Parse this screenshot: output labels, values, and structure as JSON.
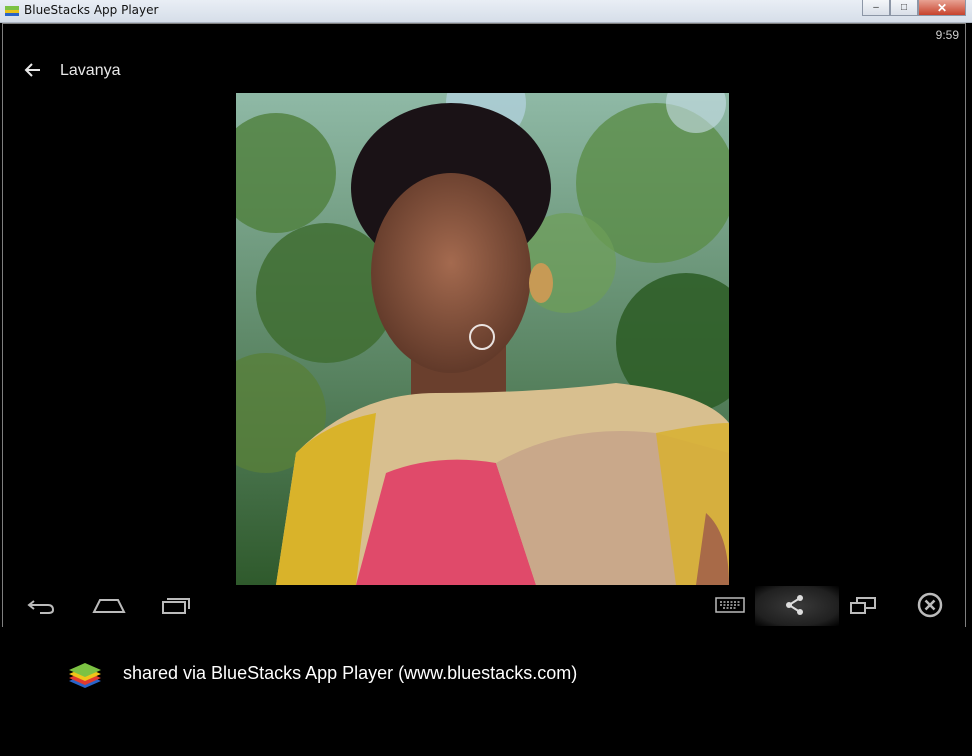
{
  "window": {
    "title": "BlueStacks App Player",
    "minimize_icon": "minimize-icon",
    "maximize_icon": "maximize-icon",
    "close_icon": "close-icon"
  },
  "status_bar": {
    "time": "9:59"
  },
  "action_bar": {
    "back_icon": "arrow-left-icon",
    "title": "Lavanya"
  },
  "photo": {
    "subject": "contact-photo"
  },
  "nav_bar": {
    "left": [
      "back-icon",
      "home-icon",
      "recent-apps-icon"
    ],
    "right": [
      "keyboard-icon",
      "share-icon",
      "multi-window-icon",
      "close-circle-icon"
    ]
  },
  "caption": {
    "text": "shared via BlueStacks App Player (www.bluestacks.com)"
  },
  "colors": {
    "background": "#000000",
    "titlebar": "#dde4ee",
    "text": "#ffffff"
  }
}
